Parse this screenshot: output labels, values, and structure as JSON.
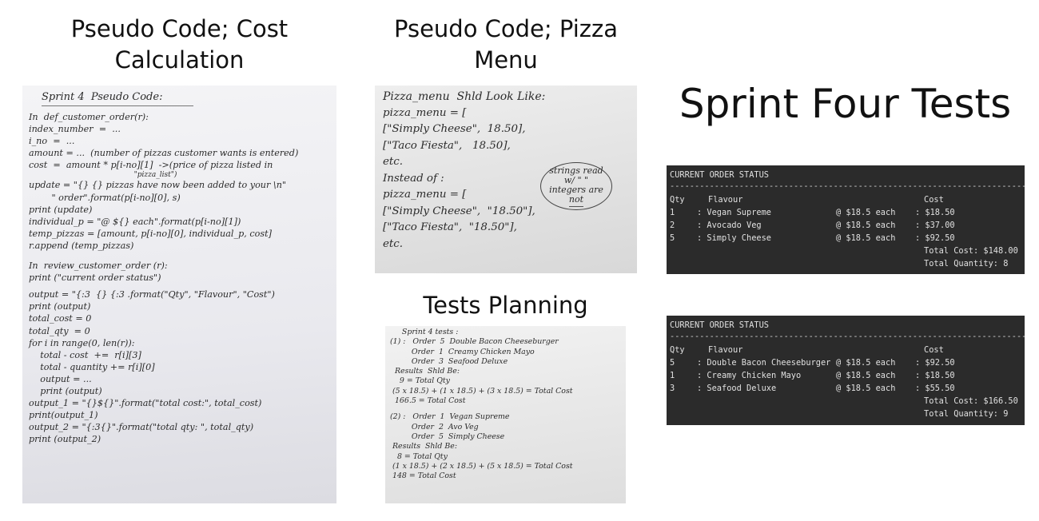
{
  "headings": {
    "cost_calculation": [
      "Pseudo Code; Cost",
      "Calculation"
    ],
    "pizza_menu": [
      "Pseudo Code; Pizza",
      "Menu"
    ],
    "tests_planning": "Tests Planning",
    "sprint_four_tests": "Sprint Four Tests"
  },
  "note_cost": {
    "lines": [
      "Sprint 4  Pseudo Code:",
      "",
      "In  def_customer_order(r):",
      "index_number  =  ...",
      "i_no  =  ...",
      "amount = ...  (number of pizzas customer wants is entered)",
      "cost  =  amount * p[i-no][1]  ->(price of pizza listed in",
      "                                              \"pizza_list\")",
      "update = \"{} {} pizzas have now been added to your \\n\"",
      "        \" order\".format(p[i-no][0], s)",
      "print (update)",
      "individual_p = \"@ ${} each\".format(p[i-no][1])",
      "temp_pizzas = [amount, p[i-no][0], individual_p, cost]",
      "r.append (temp_pizzas)",
      "",
      "In  review_customer_order (r):",
      "print (\"current order status\")",
      "",
      "output = \"{:3  {} {:3 .format(\"Qty\", \"Flavour\", \"Cost\")",
      "print (output)",
      "total_cost = 0",
      "total_qty  = 0",
      "for i in range(0, len(r)):",
      "    total - cost  +=  r[i][3]",
      "    total - quantity += r[i][0]",
      "    output = ...",
      "    print (output)",
      "output_1 = \"{}${}\".format(\"total cost:\", total_cost)",
      "print(output_1)",
      "output_2 = \"{:3{}\".format(\"total qty: \", total_qty)",
      "print (output_2)"
    ]
  },
  "note_menu": {
    "title": "Pizza_menu  Shld Look Like:",
    "lines": [
      "pizza_menu = [",
      "[\"Simply Cheese\",  18.50],",
      "[\"Taco Fiesta\",   18.50],",
      "etc.",
      "Instead of :",
      "pizza_menu = [",
      "[\"Simply Cheese\",  \"18.50\"],",
      "[\"Taco Fiesta\",  \"18.50\"],",
      "etc."
    ],
    "bubble": [
      "strings read",
      "w/ \" \"",
      "integers are",
      "not"
    ]
  },
  "note_tests": {
    "lines": [
      "     Sprint 4 tests :",
      "(1) :   Order  5  Double Bacon Cheeseburger",
      "         Order  1  Creamy Chicken Mayo",
      "         Order  3  Seafood Deluxe",
      "  Results  Shld Be:",
      "    9 = Total Qty",
      " (5 x 18.5) + (1 x 18.5) + (3 x 18.5) = Total Cost",
      "  166.5 = Total Cost",
      "",
      "(2) :   Order  1  Vegan Supreme",
      "         Order  2  Avo Veg",
      "         Order  5  Simply Cheese",
      " Results  Shld Be:",
      "   8 = Total Qty",
      " (1 x 18.5) + (2 x 18.5) + (5 x 18.5) = Total Cost",
      " 148 = Total Cost"
    ]
  },
  "terminal_1": {
    "status": "CURRENT ORDER STATUS",
    "header": {
      "qty": "Qty",
      "flavour": "Flavour",
      "cost": "Cost"
    },
    "rows": [
      {
        "qty": "1",
        "flavour": ": Vegan Supreme",
        "each": "@ $18.5 each",
        "cost": ": $18.50"
      },
      {
        "qty": "2",
        "flavour": ": Avocado Veg",
        "each": "@ $18.5 each",
        "cost": ": $37.00"
      },
      {
        "qty": "5",
        "flavour": ": Simply Cheese",
        "each": "@ $18.5 each",
        "cost": ": $92.50"
      }
    ],
    "total_cost": "Total Cost: $148.00",
    "total_quantity": "Total Quantity: 8"
  },
  "terminal_2": {
    "status": "CURRENT ORDER STATUS",
    "header": {
      "qty": "Qty",
      "flavour": "Flavour",
      "cost": "Cost"
    },
    "rows": [
      {
        "qty": "5",
        "flavour": ": Double Bacon Cheeseburger",
        "each": "@ $18.5 each",
        "cost": ": $92.50"
      },
      {
        "qty": "1",
        "flavour": ": Creamy Chicken Mayo",
        "each": "@ $18.5 each",
        "cost": ": $18.50"
      },
      {
        "qty": "3",
        "flavour": ": Seafood Deluxe",
        "each": "@ $18.5 each",
        "cost": ": $55.50"
      }
    ],
    "total_cost": "Total Cost: $166.50",
    "total_quantity": "Total Quantity: 9"
  },
  "colors": {
    "terminal_bg": "#2b2b2b",
    "terminal_text": "#e0e0e0"
  }
}
